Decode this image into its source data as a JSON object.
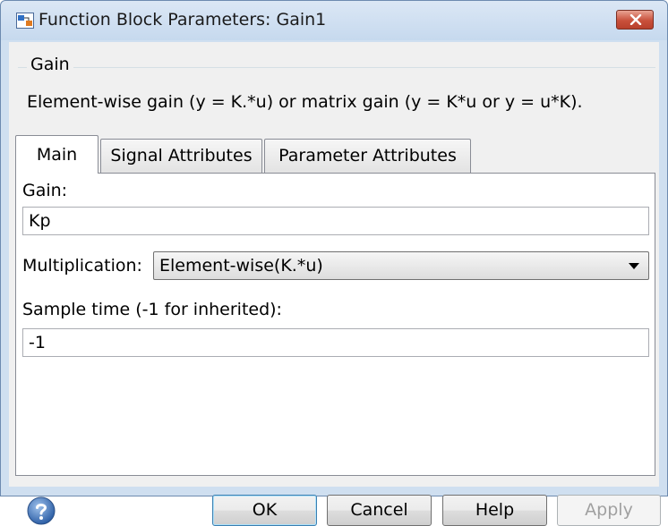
{
  "window": {
    "title": "Function Block Parameters: Gain1"
  },
  "group": {
    "title": "Gain",
    "description": "Element-wise gain (y = K.*u) or matrix gain (y = K*u or y = u*K)."
  },
  "tabs": [
    {
      "label": "Main",
      "active": true
    },
    {
      "label": "Signal Attributes",
      "active": false
    },
    {
      "label": "Parameter Attributes",
      "active": false
    }
  ],
  "main": {
    "gain_label": "Gain:",
    "gain_value": "Kp",
    "multiplication_label": "Multiplication:",
    "multiplication_value": "Element-wise(K.*u)",
    "sample_time_label": "Sample time (-1 for inherited):",
    "sample_time_value": "-1"
  },
  "buttons": {
    "ok": "OK",
    "cancel": "Cancel",
    "help": "Help",
    "apply": "Apply"
  },
  "colors": {
    "titlebar": "#c6d9ee",
    "close_button": "#c9503b",
    "panel_background": "#f0f0f0"
  }
}
